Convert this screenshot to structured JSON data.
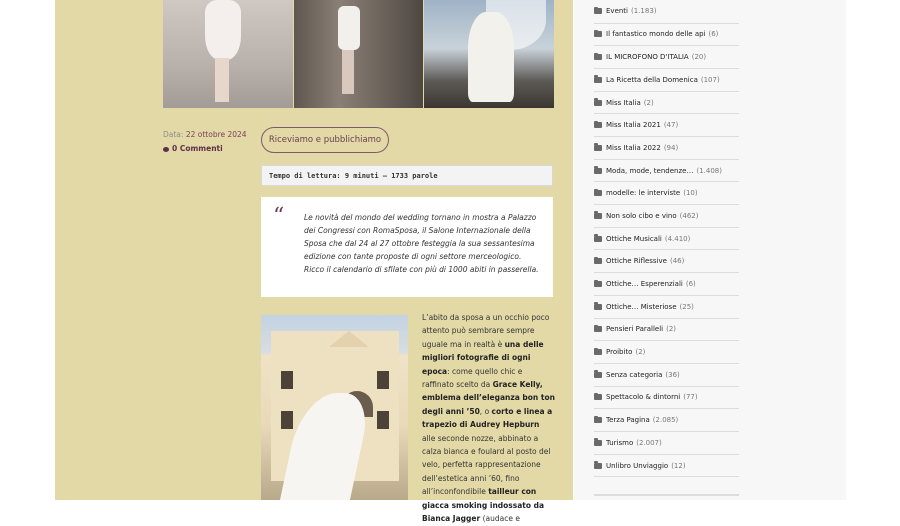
{
  "post": {
    "meta": {
      "date_label": "Data:",
      "date": "22 ottobre 2024",
      "comments": "0 Commenti"
    },
    "category_button": "Riceviamo e pubblichiamo",
    "reading_time": "Tempo di lettura: 9 minuti — 1733 parole",
    "quote": "Le novità del mondo del wedding tornano in mostra a Palazzo dei Congressi con RomaSposa, il Salone Internazionale della Sposa che dal 24 al 27 ottobre festeggia la sua sessantesima edizione con tante proposte di ogni settore merceologico. Ricco il calendario di sfilate con più di 1000 abiti in passerella.",
    "body": {
      "t1": "L’abito da sposa a un occhio poco attento può sembrare sempre uguale ma in realtà è ",
      "b1": "una delle migliori fotografie di ogni epoca",
      "t2": ": come quello chic e raffinato scelto da ",
      "b2": "Grace Kelly, emblema dell’eleganza bon ton degli anni ’50",
      "t3": ", o ",
      "b3": "corto e linea a trapezio di Audrey Hepburn",
      "t4": " alle seconde nozze, abbinato a calza bianca e foulard al posto del velo, perfetta rappresentazione dell’estetica anni ’60, fino all’inconfondibile ",
      "b4": "tailleur con giacca smoking indossato da Bianca Jagger",
      "t5": " (audace e"
    }
  },
  "sidebar": {
    "categories": [
      {
        "label": "Eventi",
        "count": "(1.183)"
      },
      {
        "label": "Il fantastico mondo delle api",
        "count": "(6)"
      },
      {
        "label": "IL MICROFONO D'ITALIA",
        "count": "(20)"
      },
      {
        "label": "La Ricetta della Domenica",
        "count": "(107)"
      },
      {
        "label": "Miss Italia",
        "count": "(2)"
      },
      {
        "label": "Miss Italia 2021",
        "count": "(47)"
      },
      {
        "label": "Miss Italia 2022",
        "count": "(94)"
      },
      {
        "label": "Moda, mode, tendenze…",
        "count": "(1.408)"
      },
      {
        "label": "modelle: le interviste",
        "count": "(10)"
      },
      {
        "label": "Non solo cibo e vino",
        "count": "(462)"
      },
      {
        "label": "Ottiche Musicali",
        "count": "(4.410)"
      },
      {
        "label": "Ottiche Riflessive",
        "count": "(46)"
      },
      {
        "label": "Ottiche… Esperenziali",
        "count": "(6)"
      },
      {
        "label": "Ottiche… Misteriose",
        "count": "(25)"
      },
      {
        "label": "Pensieri Paralleli",
        "count": "(2)"
      },
      {
        "label": "Proibito",
        "count": "(2)"
      },
      {
        "label": "Senza categoria",
        "count": "(36)"
      },
      {
        "label": "Spettacolo & dintorni",
        "count": "(77)"
      },
      {
        "label": "Terza Pagina",
        "count": "(2.085)"
      },
      {
        "label": "Turismo",
        "count": "(2.007)"
      },
      {
        "label": "Unlibro Unviaggio",
        "count": "(12)"
      }
    ]
  }
}
